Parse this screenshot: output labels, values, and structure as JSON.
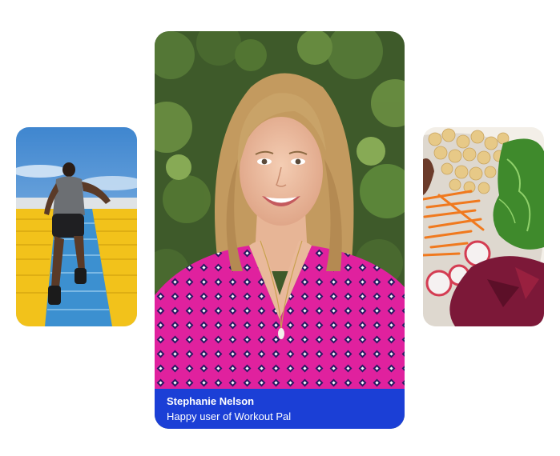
{
  "testimonial": {
    "name": "Stephanie Nelson",
    "subtitle": "Happy user of Workout Pal"
  },
  "images": {
    "left": "runner-on-stadium-stairs",
    "center": "smiling-woman-portrait",
    "right": "healthy-food-bowl"
  },
  "colors": {
    "caption_bg": "#1b3fd6",
    "dress": "#e0219e",
    "stadium_seats": "#f2c21b",
    "sky": "#4d93d6"
  }
}
